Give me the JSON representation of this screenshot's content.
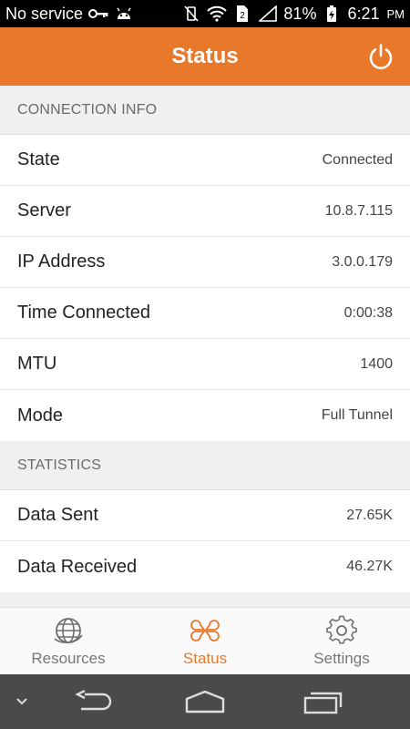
{
  "status_bar": {
    "carrier": "No service",
    "battery": "81%",
    "time": "6:21",
    "ampm": "PM"
  },
  "app_bar": {
    "title": "Status"
  },
  "connection_info": {
    "header": "CONNECTION INFO",
    "rows": [
      {
        "label": "State",
        "value": "Connected"
      },
      {
        "label": "Server",
        "value": "10.8.7.115"
      },
      {
        "label": "IP Address",
        "value": "3.0.0.179"
      },
      {
        "label": "Time Connected",
        "value": "0:00:38"
      },
      {
        "label": "MTU",
        "value": "1400"
      },
      {
        "label": "Mode",
        "value": "Full Tunnel"
      }
    ]
  },
  "statistics": {
    "header": "STATISTICS",
    "rows": [
      {
        "label": "Data Sent",
        "value": "27.65K"
      },
      {
        "label": "Data Received",
        "value": "46.27K"
      }
    ]
  },
  "tabs": [
    {
      "label": "Resources",
      "icon": "globe-icon",
      "active": false
    },
    {
      "label": "Status",
      "icon": "status-grid-icon",
      "active": true
    },
    {
      "label": "Settings",
      "icon": "gear-icon",
      "active": false
    }
  ],
  "colors": {
    "accent": "#e8782a",
    "background": "#f0f0f0",
    "nav_bar": "#4a4a4a"
  }
}
